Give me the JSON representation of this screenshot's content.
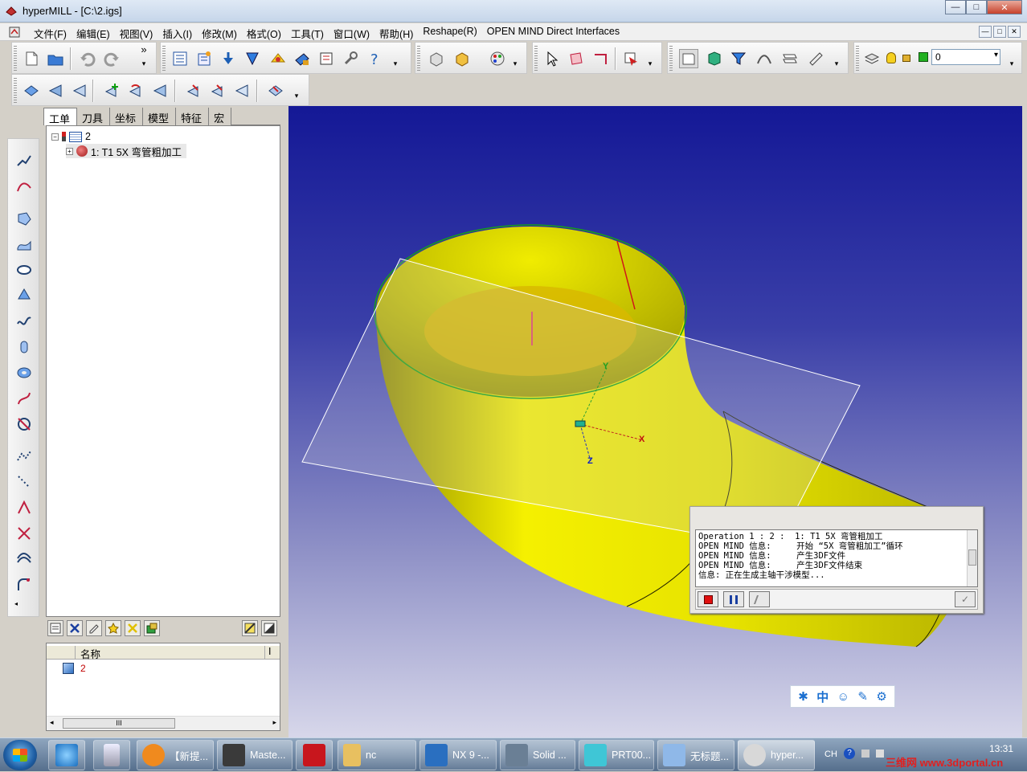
{
  "window": {
    "title": "hyperMILL - [C:\\2.igs]",
    "buttons": [
      "—",
      "□",
      "✕"
    ]
  },
  "menu": {
    "items": [
      "文件(F)",
      "编辑(E)",
      "视图(V)",
      "插入(I)",
      "修改(M)",
      "格式(O)",
      "工具(T)",
      "窗口(W)",
      "帮助(H)",
      "Reshape(R)",
      "OPEN MIND Direct Interfaces"
    ],
    "mdi_buttons": [
      "—",
      "□",
      "✕"
    ]
  },
  "toolbar": {
    "chevron": "»",
    "layer_value": "0",
    "dropdown_arrow": "▾"
  },
  "panel": {
    "tabs": [
      "工单",
      "刀具",
      "坐标",
      "模型",
      "特征",
      "宏"
    ],
    "tree": {
      "root_label": "2",
      "child_label": "1: T1 5X 弯管粗加工",
      "expander_minus": "−",
      "expander_plus": "+"
    },
    "list": {
      "header_name": "名称",
      "header_col2": "I",
      "item_label": "2"
    },
    "scroll": {
      "thumb": "III",
      "left": "◂",
      "right": "▸"
    }
  },
  "viewport": {
    "axis_labels": {
      "x": "X",
      "y": "Y",
      "z": "Z"
    },
    "colors": {
      "part": "#f5f000",
      "bg_top": "#141896",
      "bg_bottom": "#d7d7ea"
    }
  },
  "message_window": {
    "lines": [
      "Operation 1 : 2 :  1: T1 5X 弯管粗加工",
      "OPEN MIND 信息:     开始 “5X 弯管粗加工”循环",
      "OPEN MIND 信息:     产生3DF文件",
      "OPEN MIND 信息:     产生3DF文件结束",
      "信息: 正在生成主轴干涉模型..."
    ]
  },
  "ime_bar": {
    "lang": "中"
  },
  "taskbar": {
    "tasks": [
      {
        "label": "【新提...",
        "color": "#f08a1e"
      },
      {
        "label": "Maste...",
        "color": "#3a3a3a"
      },
      {
        "label": "",
        "color": "#c8161d"
      },
      {
        "label": "nc",
        "color": "#e8c060"
      },
      {
        "label": "NX 9 -...",
        "color": "#2a6fc0"
      },
      {
        "label": "Solid ...",
        "color": "#6a7f95"
      },
      {
        "label": "PRT00...",
        "color": "#3fc6d6"
      },
      {
        "label": "无标题...",
        "color": "#8fb8e8"
      },
      {
        "label": "hyper...",
        "color": "#d8d8d8"
      }
    ],
    "lang": "CH",
    "clock_time": "13:31",
    "watermark": "三维网 www.3dportal.cn"
  }
}
